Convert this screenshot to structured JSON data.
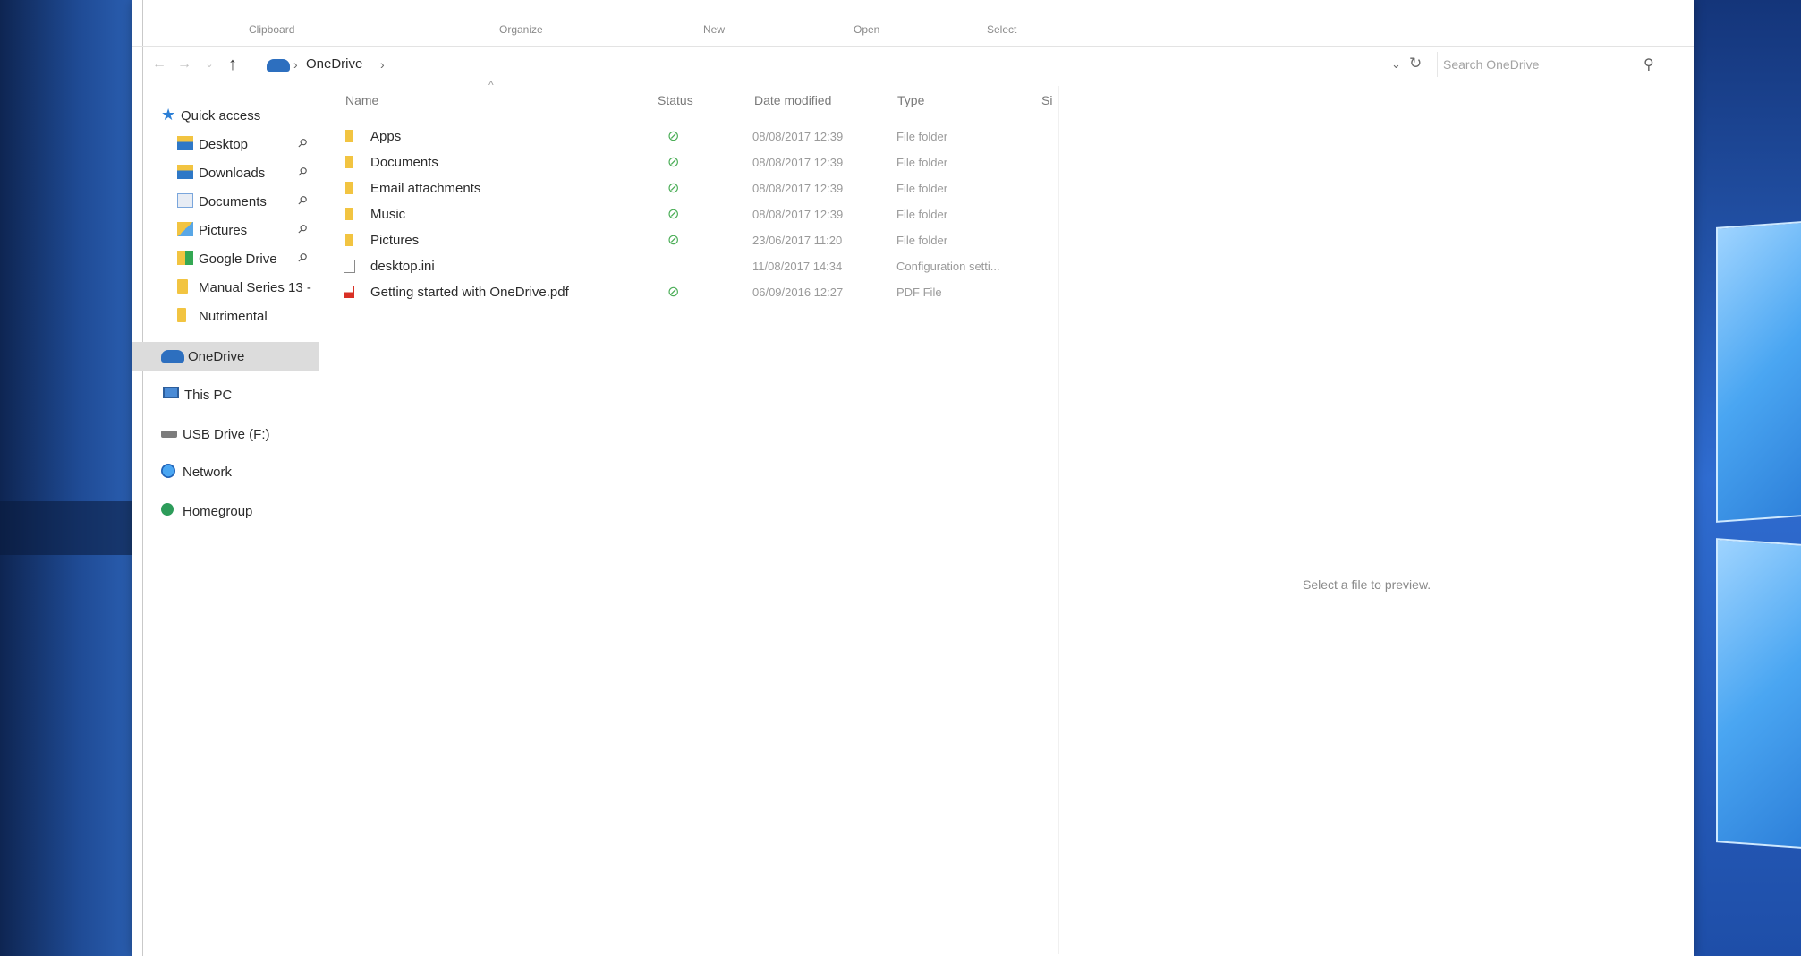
{
  "ribbon": {
    "groups": [
      "Clipboard",
      "Organize",
      "New",
      "Open",
      "Select"
    ]
  },
  "address_bar": {
    "location_icon": "onedrive-cloud-icon",
    "crumbs": [
      "OneDrive"
    ],
    "search_placeholder": "Search OneDrive"
  },
  "nav_pane": {
    "quick_access": "Quick access",
    "items": [
      {
        "label": "Desktop",
        "icon": "desktop-folder-icon",
        "pinned": true
      },
      {
        "label": "Downloads",
        "icon": "downloads-folder-icon",
        "pinned": true
      },
      {
        "label": "Documents",
        "icon": "documents-folder-icon",
        "pinned": true
      },
      {
        "label": "Pictures",
        "icon": "pictures-folder-icon",
        "pinned": true
      },
      {
        "label": "Google Drive",
        "icon": "google-drive-icon",
        "pinned": true
      },
      {
        "label": "Manual Series 13 -",
        "icon": "folder-icon",
        "pinned": false
      },
      {
        "label": "Nutrimental",
        "icon": "folder-icon",
        "pinned": false
      }
    ],
    "onedrive": "OneDrive",
    "this_pc": "This PC",
    "usb_drive": "USB Drive (F:)",
    "network": "Network",
    "homegroup": "Homegroup"
  },
  "file_list": {
    "columns": {
      "name": "Name",
      "status": "Status",
      "date_modified": "Date modified",
      "type": "Type",
      "size": "Si"
    },
    "rows": [
      {
        "name": "Apps",
        "icon": "folder-icon",
        "status": "synced",
        "date": "08/08/2017 12:39",
        "type": "File folder"
      },
      {
        "name": "Documents",
        "icon": "folder-icon",
        "status": "synced",
        "date": "08/08/2017 12:39",
        "type": "File folder"
      },
      {
        "name": "Email attachments",
        "icon": "folder-icon",
        "status": "synced",
        "date": "08/08/2017 12:39",
        "type": "File folder"
      },
      {
        "name": "Music",
        "icon": "folder-icon",
        "status": "synced",
        "date": "08/08/2017 12:39",
        "type": "File folder"
      },
      {
        "name": "Pictures",
        "icon": "folder-icon",
        "status": "synced",
        "date": "23/06/2017 11:20",
        "type": "File folder"
      },
      {
        "name": "desktop.ini",
        "icon": "ini-file-icon",
        "status": "",
        "date": "11/08/2017 14:34",
        "type": "Configuration setti..."
      },
      {
        "name": "Getting started with OneDrive.pdf",
        "icon": "pdf-file-icon",
        "status": "synced",
        "date": "06/09/2016 12:27",
        "type": "PDF File"
      }
    ]
  },
  "preview_pane": {
    "message": "Select a file to preview."
  },
  "colors": {
    "status_synced": "#4cae58",
    "folder": "#f2c441",
    "onedrive_blue": "#2d6fbf",
    "selection": "#dcdcdc"
  }
}
